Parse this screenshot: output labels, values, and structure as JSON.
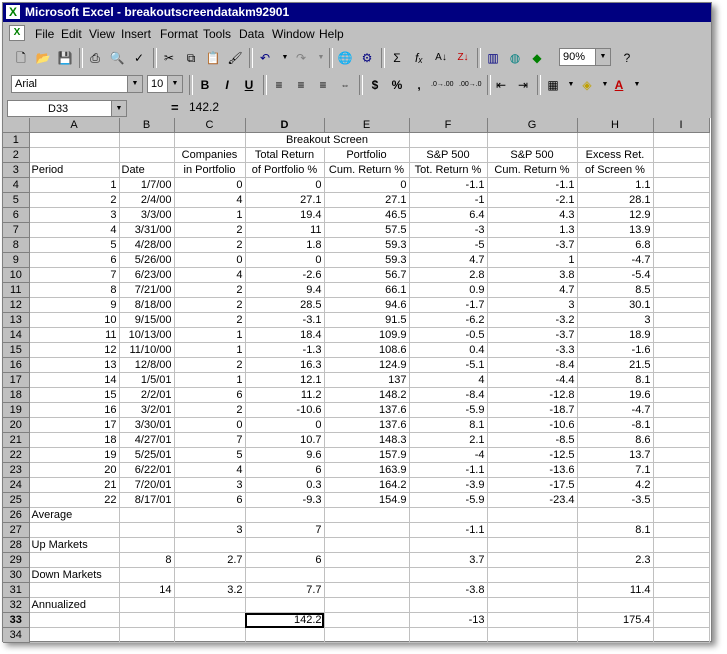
{
  "window": {
    "title": "Microsoft Excel - breakoutscreendatakm92901"
  },
  "menu": [
    "File",
    "Edit",
    "View",
    "Insert",
    "Format",
    "Tools",
    "Data",
    "Window",
    "Help"
  ],
  "toolbar": {
    "zoom": "90%",
    "font_name": "Arial",
    "font_size": "10",
    "bold": "B",
    "italic": "I",
    "underline": "U",
    "currency": "$",
    "percent": "%",
    "comma": ",",
    "inc_decimal": ".0→.00",
    "dec_decimal": ".00→.0",
    "autosum": "Σ",
    "function": "fₓ"
  },
  "formula_bar": {
    "name_box": "D33",
    "equals": "=",
    "value": "142.2"
  },
  "grid": {
    "columns": [
      "A",
      "B",
      "C",
      "D",
      "E",
      "F",
      "G",
      "H",
      "I"
    ],
    "rows": [
      [
        "",
        "",
        "",
        "Breakout Screen",
        "",
        "",
        "",
        "",
        ""
      ],
      [
        "",
        "",
        "Companies",
        "Total Return",
        "Portfolio",
        "S&P 500",
        "S&P 500",
        "Excess Ret.",
        ""
      ],
      [
        "Period",
        "Date",
        "in Portfolio",
        "of Portfolio %",
        "Cum. Return %",
        "Tot. Return %",
        "Cum. Return %",
        "of Screen %",
        ""
      ],
      [
        "1",
        "1/7/00",
        "0",
        "0",
        "0",
        "-1.1",
        "-1.1",
        "1.1",
        ""
      ],
      [
        "2",
        "2/4/00",
        "4",
        "27.1",
        "27.1",
        "-1",
        "-2.1",
        "28.1",
        ""
      ],
      [
        "3",
        "3/3/00",
        "1",
        "19.4",
        "46.5",
        "6.4",
        "4.3",
        "12.9",
        ""
      ],
      [
        "4",
        "3/31/00",
        "2",
        "11",
        "57.5",
        "-3",
        "1.3",
        "13.9",
        ""
      ],
      [
        "5",
        "4/28/00",
        "2",
        "1.8",
        "59.3",
        "-5",
        "-3.7",
        "6.8",
        ""
      ],
      [
        "6",
        "5/26/00",
        "0",
        "0",
        "59.3",
        "4.7",
        "1",
        "-4.7",
        ""
      ],
      [
        "7",
        "6/23/00",
        "4",
        "-2.6",
        "56.7",
        "2.8",
        "3.8",
        "-5.4",
        ""
      ],
      [
        "8",
        "7/21/00",
        "2",
        "9.4",
        "66.1",
        "0.9",
        "4.7",
        "8.5",
        ""
      ],
      [
        "9",
        "8/18/00",
        "2",
        "28.5",
        "94.6",
        "-1.7",
        "3",
        "30.1",
        ""
      ],
      [
        "10",
        "9/15/00",
        "2",
        "-3.1",
        "91.5",
        "-6.2",
        "-3.2",
        "3",
        ""
      ],
      [
        "11",
        "10/13/00",
        "1",
        "18.4",
        "109.9",
        "-0.5",
        "-3.7",
        "18.9",
        ""
      ],
      [
        "12",
        "11/10/00",
        "1",
        "-1.3",
        "108.6",
        "0.4",
        "-3.3",
        "-1.6",
        ""
      ],
      [
        "13",
        "12/8/00",
        "2",
        "16.3",
        "124.9",
        "-5.1",
        "-8.4",
        "21.5",
        ""
      ],
      [
        "14",
        "1/5/01",
        "1",
        "12.1",
        "137",
        "4",
        "-4.4",
        "8.1",
        ""
      ],
      [
        "15",
        "2/2/01",
        "6",
        "11.2",
        "148.2",
        "-8.4",
        "-12.8",
        "19.6",
        ""
      ],
      [
        "16",
        "3/2/01",
        "2",
        "-10.6",
        "137.6",
        "-5.9",
        "-18.7",
        "-4.7",
        ""
      ],
      [
        "17",
        "3/30/01",
        "0",
        "0",
        "137.6",
        "8.1",
        "-10.6",
        "-8.1",
        ""
      ],
      [
        "18",
        "4/27/01",
        "7",
        "10.7",
        "148.3",
        "2.1",
        "-8.5",
        "8.6",
        ""
      ],
      [
        "19",
        "5/25/01",
        "5",
        "9.6",
        "157.9",
        "-4",
        "-12.5",
        "13.7",
        ""
      ],
      [
        "20",
        "6/22/01",
        "4",
        "6",
        "163.9",
        "-1.1",
        "-13.6",
        "7.1",
        ""
      ],
      [
        "21",
        "7/20/01",
        "3",
        "0.3",
        "164.2",
        "-3.9",
        "-17.5",
        "4.2",
        ""
      ],
      [
        "22",
        "8/17/01",
        "6",
        "-9.3",
        "154.9",
        "-5.9",
        "-23.4",
        "-3.5",
        ""
      ],
      [
        "Average",
        "",
        "",
        "",
        "",
        "",
        "",
        "",
        ""
      ],
      [
        "",
        "",
        "3",
        "7",
        "",
        "-1.1",
        "",
        "8.1",
        ""
      ],
      [
        " Up Markets",
        "",
        "",
        "",
        "",
        "",
        "",
        "",
        ""
      ],
      [
        "",
        "8",
        "2.7",
        "6",
        "",
        "3.7",
        "",
        "2.3",
        ""
      ],
      [
        " Down Markets",
        "",
        "",
        "",
        "",
        "",
        "",
        "",
        ""
      ],
      [
        "",
        "14",
        "3.2",
        "7.7",
        "",
        "-3.8",
        "",
        "11.4",
        ""
      ],
      [
        " Annualized",
        "",
        "",
        "",
        "",
        "",
        "",
        "",
        ""
      ],
      [
        "",
        "",
        "",
        "142.2",
        "",
        "-13",
        "",
        "175.4",
        ""
      ],
      [
        "",
        "",
        "",
        "",
        "",
        "",
        "",
        "",
        ""
      ]
    ]
  }
}
